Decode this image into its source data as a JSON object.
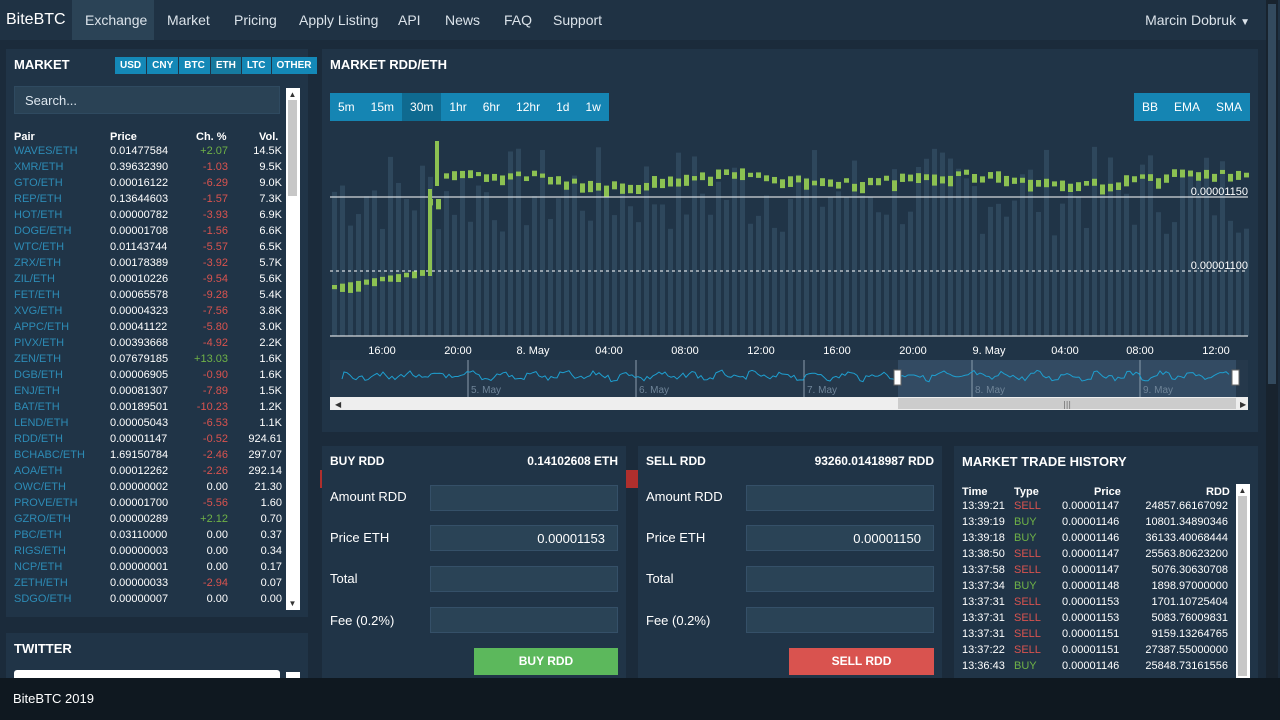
{
  "nav": {
    "brand": "BiteBTC",
    "items": [
      "Exchange",
      "Market",
      "Pricing",
      "Apply Listing",
      "API",
      "News",
      "FAQ",
      "Support"
    ],
    "user": "Marcin Dobruk"
  },
  "market": {
    "title": "MARKET",
    "currencies": [
      "USD",
      "CNY",
      "BTC",
      "ETH",
      "LTC",
      "OTHER"
    ],
    "search_placeholder": "Search...",
    "headers": [
      "Pair",
      "Price",
      "Ch. %",
      "Vol."
    ],
    "rows": [
      {
        "pair": "WAVES/ETH",
        "price": "0.01477584",
        "chg": "+2.07",
        "vol": "14.5K"
      },
      {
        "pair": "XMR/ETH",
        "price": "0.39632390",
        "chg": "-1.03",
        "vol": "9.5K"
      },
      {
        "pair": "GTO/ETH",
        "price": "0.00016122",
        "chg": "-6.29",
        "vol": "9.0K"
      },
      {
        "pair": "REP/ETH",
        "price": "0.13644603",
        "chg": "-1.57",
        "vol": "7.3K"
      },
      {
        "pair": "HOT/ETH",
        "price": "0.00000782",
        "chg": "-3.93",
        "vol": "6.9K"
      },
      {
        "pair": "DOGE/ETH",
        "price": "0.00001708",
        "chg": "-1.56",
        "vol": "6.6K"
      },
      {
        "pair": "WTC/ETH",
        "price": "0.01143744",
        "chg": "-5.57",
        "vol": "6.5K"
      },
      {
        "pair": "ZRX/ETH",
        "price": "0.00178389",
        "chg": "-3.92",
        "vol": "5.7K"
      },
      {
        "pair": "ZIL/ETH",
        "price": "0.00010226",
        "chg": "-9.54",
        "vol": "5.6K"
      },
      {
        "pair": "FET/ETH",
        "price": "0.00065578",
        "chg": "-9.28",
        "vol": "5.4K"
      },
      {
        "pair": "XVG/ETH",
        "price": "0.00004323",
        "chg": "-7.56",
        "vol": "3.8K"
      },
      {
        "pair": "APPC/ETH",
        "price": "0.00041122",
        "chg": "-5.80",
        "vol": "3.0K"
      },
      {
        "pair": "PIVX/ETH",
        "price": "0.00393668",
        "chg": "-4.92",
        "vol": "2.2K"
      },
      {
        "pair": "ZEN/ETH",
        "price": "0.07679185",
        "chg": "+13.03",
        "vol": "1.6K"
      },
      {
        "pair": "DGB/ETH",
        "price": "0.00006905",
        "chg": "-0.90",
        "vol": "1.6K"
      },
      {
        "pair": "ENJ/ETH",
        "price": "0.00081307",
        "chg": "-7.89",
        "vol": "1.5K"
      },
      {
        "pair": "BAT/ETH",
        "price": "0.00189501",
        "chg": "-10.23",
        "vol": "1.2K"
      },
      {
        "pair": "LEND/ETH",
        "price": "0.00005043",
        "chg": "-6.53",
        "vol": "1.1K"
      },
      {
        "pair": "RDD/ETH",
        "price": "0.00001147",
        "chg": "-0.52",
        "vol": "924.61"
      },
      {
        "pair": "BCHABC/ETH",
        "price": "1.69150784",
        "chg": "-2.46",
        "vol": "297.07"
      },
      {
        "pair": "AOA/ETH",
        "price": "0.00012262",
        "chg": "-2.26",
        "vol": "292.14"
      },
      {
        "pair": "OWC/ETH",
        "price": "0.00000002",
        "chg": "0.00",
        "vol": "21.30"
      },
      {
        "pair": "PROVE/ETH",
        "price": "0.00001700",
        "chg": "-5.56",
        "vol": "1.60"
      },
      {
        "pair": "GZRO/ETH",
        "price": "0.00000289",
        "chg": "+2.12",
        "vol": "0.70"
      },
      {
        "pair": "PBC/ETH",
        "price": "0.03110000",
        "chg": "0.00",
        "vol": "0.37"
      },
      {
        "pair": "RIGS/ETH",
        "price": "0.00000003",
        "chg": "0.00",
        "vol": "0.34"
      },
      {
        "pair": "NCP/ETH",
        "price": "0.00000001",
        "chg": "0.00",
        "vol": "0.17"
      },
      {
        "pair": "ZETH/ETH",
        "price": "0.00000033",
        "chg": "-2.94",
        "vol": "0.07"
      },
      {
        "pair": "SDGO/ETH",
        "price": "0.00000007",
        "chg": "0.00",
        "vol": "0.00"
      }
    ]
  },
  "twitter": {
    "title": "TWITTER"
  },
  "chart": {
    "title": "MARKET RDD/ETH",
    "timeframes": [
      "5m",
      "15m",
      "30m",
      "1hr",
      "6hr",
      "12hr",
      "1d",
      "1w"
    ],
    "active_timeframe": "30m",
    "indicators": [
      "BB",
      "EMA",
      "SMA"
    ],
    "price_levels": [
      "0.00001150",
      "0.00001100"
    ],
    "time_ticks": [
      "16:00",
      "20:00",
      "8. May",
      "04:00",
      "08:00",
      "12:00",
      "16:00",
      "20:00",
      "9. May",
      "04:00",
      "08:00",
      "12:00"
    ],
    "navigator_days": [
      "5. May",
      "6. May",
      "7. May",
      "8. May",
      "9. May"
    ],
    "colors": {
      "up": "#8cc152",
      "volume": "#2e475c",
      "navigator": "#1e9fd0"
    }
  },
  "buy": {
    "title": "BUY RDD",
    "balance": "0.14102608 ETH",
    "amount_label": "Amount RDD",
    "price_label": "Price ETH",
    "price_value": "0.00001153",
    "total_label": "Total",
    "fee_label": "Fee (0.2%)",
    "button": "BUY RDD"
  },
  "sell": {
    "title": "SELL RDD",
    "balance": "93260.01418987 RDD",
    "amount_label": "Amount RDD",
    "price_label": "Price ETH",
    "price_value": "0.00001150",
    "total_label": "Total",
    "fee_label": "Fee (0.2%)",
    "button": "SELL RDD"
  },
  "history": {
    "title": "MARKET TRADE HISTORY",
    "headers": [
      "Time",
      "Type",
      "Price",
      "RDD"
    ],
    "rows": [
      {
        "time": "13:39:21",
        "type": "SELL",
        "price": "0.00001147",
        "amount": "24857.66167092"
      },
      {
        "time": "13:39:19",
        "type": "BUY",
        "price": "0.00001146",
        "amount": "10801.34890346"
      },
      {
        "time": "13:39:18",
        "type": "BUY",
        "price": "0.00001146",
        "amount": "36133.40068444"
      },
      {
        "time": "13:38:50",
        "type": "SELL",
        "price": "0.00001147",
        "amount": "25563.80623200"
      },
      {
        "time": "13:37:58",
        "type": "SELL",
        "price": "0.00001147",
        "amount": "5076.30630708"
      },
      {
        "time": "13:37:34",
        "type": "BUY",
        "price": "0.00001148",
        "amount": "1898.97000000"
      },
      {
        "time": "13:37:31",
        "type": "SELL",
        "price": "0.00001153",
        "amount": "1701.10725404"
      },
      {
        "time": "13:37:31",
        "type": "SELL",
        "price": "0.00001153",
        "amount": "5083.76009831"
      },
      {
        "time": "13:37:31",
        "type": "SELL",
        "price": "0.00001151",
        "amount": "9159.13264765"
      },
      {
        "time": "13:37:22",
        "type": "SELL",
        "price": "0.00001151",
        "amount": "27387.55000000"
      },
      {
        "time": "13:36:43",
        "type": "BUY",
        "price": "0.00001146",
        "amount": "25848.73161556"
      }
    ]
  },
  "footer": {
    "text": "BiteBTC 2019"
  }
}
